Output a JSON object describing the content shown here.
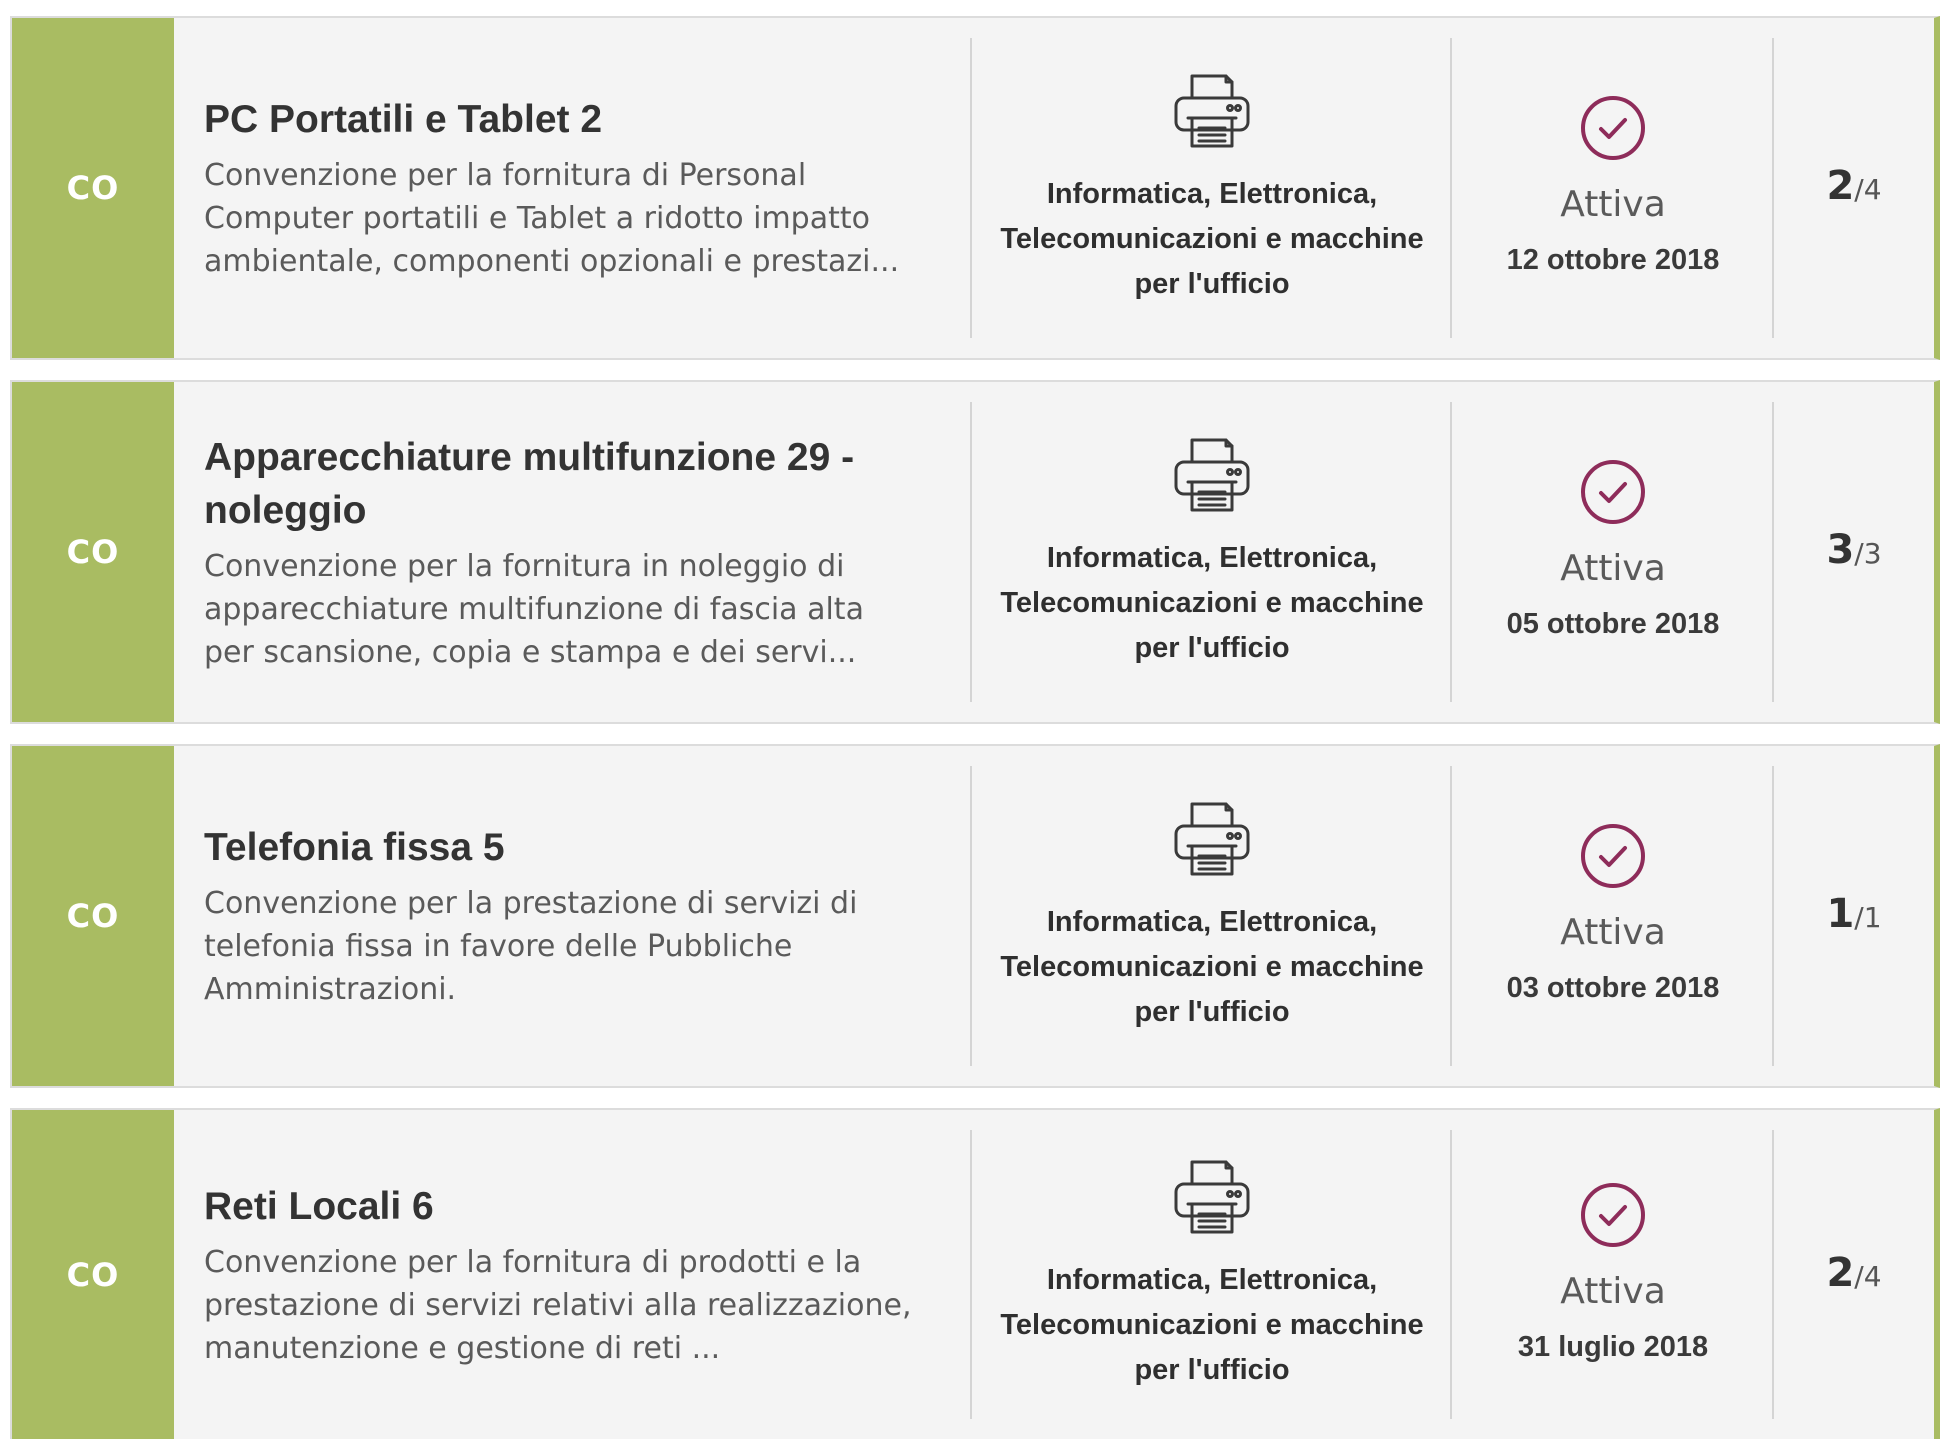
{
  "colors": {
    "accent_green": "#a9bc62",
    "status_icon": "#8e2c5a",
    "card_background": "#f4f4f4"
  },
  "lots_separator": "/",
  "cards": [
    {
      "type_badge": "CO",
      "title": "PC Portatili e Tablet 2",
      "description": "Convenzione per la fornitura di Personal Computer portatili e Tablet a ridotto impatto ambientale, componenti opzionali e prestazi...",
      "category_icon": "printer-icon",
      "category": "Informatica, Elettronica, Telecomunicazioni e macchine per l'ufficio",
      "status_icon": "check-circle-icon",
      "status": "Attiva",
      "date": "12 ottobre 2018",
      "lots_active": "2",
      "lots_total": "4"
    },
    {
      "type_badge": "CO",
      "title": "Apparecchiature multifunzione 29 - noleggio",
      "description": "Convenzione per la fornitura in noleggio di apparecchiature multifunzione di fascia alta per scansione, copia e stampa e dei servi...",
      "category_icon": "printer-icon",
      "category": "Informatica, Elettronica, Telecomunicazioni e macchine per l'ufficio",
      "status_icon": "check-circle-icon",
      "status": "Attiva",
      "date": "05 ottobre 2018",
      "lots_active": "3",
      "lots_total": "3"
    },
    {
      "type_badge": "CO",
      "title": "Telefonia fissa 5",
      "description": "Convenzione per la prestazione di servizi di telefonia fissa in favore delle Pubbliche Amministrazioni.",
      "category_icon": "printer-icon",
      "category": "Informatica, Elettronica, Telecomunicazioni e macchine per l'ufficio",
      "status_icon": "check-circle-icon",
      "status": "Attiva",
      "date": "03 ottobre 2018",
      "lots_active": "1",
      "lots_total": "1"
    },
    {
      "type_badge": "CO",
      "title": "Reti Locali 6",
      "description": "Convenzione per la fornitura di prodotti e la prestazione di servizi relativi alla realizzazione, manutenzione e gestione di reti ...",
      "category_icon": "printer-icon",
      "category": "Informatica, Elettronica, Telecomunicazioni e macchine per l'ufficio",
      "status_icon": "check-circle-icon",
      "status": "Attiva",
      "date": "31 luglio 2018",
      "lots_active": "2",
      "lots_total": "4"
    }
  ]
}
